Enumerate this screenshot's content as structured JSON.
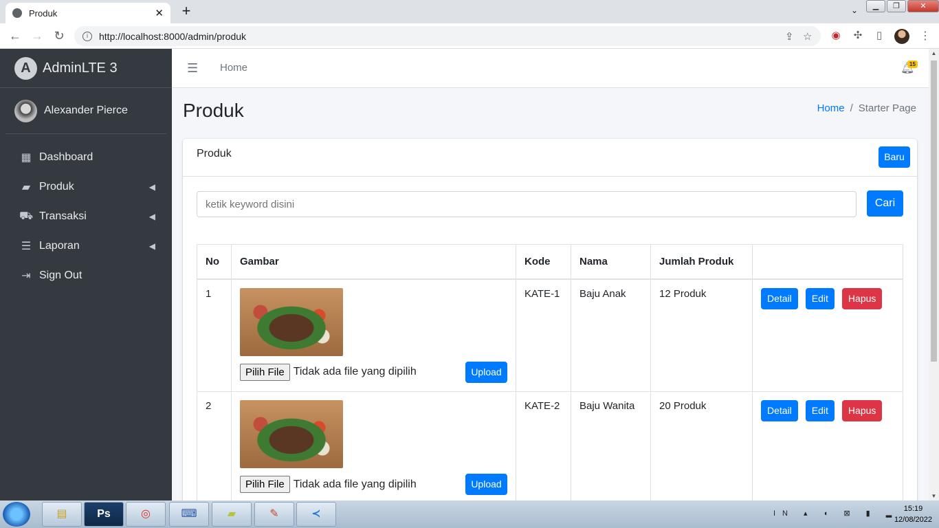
{
  "browser": {
    "tab_title": "Produk",
    "url": "http://localhost:8000/admin/produk"
  },
  "sidebar": {
    "brand": "AdminLTE 3",
    "user_name": "Alexander Pierce",
    "items": [
      {
        "label": "Dashboard",
        "icon": "grid-icon",
        "has_submenu": false
      },
      {
        "label": "Produk",
        "icon": "folder-open-icon",
        "has_submenu": true
      },
      {
        "label": "Transaksi",
        "icon": "cart-icon",
        "has_submenu": true
      },
      {
        "label": "Laporan",
        "icon": "list-icon",
        "has_submenu": true
      },
      {
        "label": "Sign Out",
        "icon": "sign-out-icon",
        "has_submenu": false
      }
    ]
  },
  "topnav": {
    "home": "Home",
    "notification_count": "15"
  },
  "header": {
    "title": "Produk",
    "breadcrumb": [
      "Home",
      "Starter Page"
    ]
  },
  "card": {
    "title": "Produk",
    "new_button": "Baru",
    "search_placeholder": "ketik keyword disini",
    "search_button": "Cari",
    "columns": [
      "No",
      "Gambar",
      "Kode",
      "Nama",
      "Jumlah Produk",
      ""
    ],
    "rows": [
      {
        "no": "1",
        "kode": "KATE-1",
        "nama": "Baju Anak",
        "jumlah": "12 Produk"
      },
      {
        "no": "2",
        "kode": "KATE-2",
        "nama": "Baju Wanita",
        "jumlah": "20 Produk"
      }
    ],
    "file_button": "Pilih File",
    "file_status": "Tidak ada file yang dipilih",
    "upload_button": "Upload",
    "actions": {
      "detail": "Detail",
      "edit": "Edit",
      "delete": "Hapus"
    }
  },
  "taskbar": {
    "time": "15:19",
    "date": "12/08/2022",
    "lang": "IN",
    "apps": [
      "explorer",
      "Ps",
      "chrome",
      "keyboard",
      "notes",
      "paint",
      "vscode"
    ]
  },
  "colors": {
    "primary": "#007bff",
    "danger": "#dc3545",
    "sidebar": "#343a40",
    "badge": "#ffc107"
  }
}
